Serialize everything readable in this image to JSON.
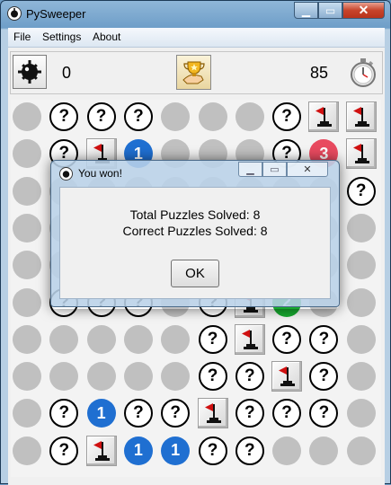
{
  "window": {
    "title": "PySweeper",
    "close_glyph": "✕",
    "min_glyph": "▁",
    "max_glyph": "▭"
  },
  "menu": {
    "items": [
      "File",
      "Settings",
      "About"
    ]
  },
  "toolbar": {
    "left_count": "0",
    "right_count": "85",
    "mine_icon": "mine-icon",
    "trophy_icon": "trophy-hand-icon",
    "timer_icon": "stopwatch-icon"
  },
  "colors": {
    "blank": "#c0c0c0",
    "one": "#1f6fd1",
    "two": "#17a82f",
    "three": "#e84a5f",
    "flag": "#d01010"
  },
  "board": {
    "rows": 10,
    "cols": 10,
    "cells": [
      [
        "b",
        "q",
        "q",
        "q",
        "b",
        "b",
        "b",
        "q",
        "f",
        "f"
      ],
      [
        "b",
        "q",
        "f",
        "1",
        "b",
        "b",
        "b",
        "q",
        "3",
        "f"
      ],
      [
        "b",
        "b",
        "b",
        "b",
        "b",
        "b",
        "b",
        "b",
        "b",
        "q"
      ],
      [
        "b",
        "b",
        "b",
        "b",
        "b",
        "b",
        "b",
        "b",
        "b",
        "b"
      ],
      [
        "b",
        "b",
        "b",
        "b",
        "b",
        "b",
        "b",
        "b",
        "b",
        "b"
      ],
      [
        "b",
        "q",
        "q",
        "q",
        "b",
        "q",
        "f",
        "2",
        "b",
        "b"
      ],
      [
        "b",
        "b",
        "b",
        "b",
        "b",
        "q",
        "f",
        "q",
        "q",
        "b"
      ],
      [
        "b",
        "b",
        "b",
        "b",
        "b",
        "q",
        "q",
        "f",
        "q",
        "b"
      ],
      [
        "b",
        "q",
        "1",
        "q",
        "q",
        "f",
        "q",
        "q",
        "q",
        "b"
      ],
      [
        "b",
        "q",
        "f",
        "1",
        "1",
        "q",
        "q",
        "b",
        "b",
        "b"
      ]
    ]
  },
  "dialog": {
    "title": "You won!",
    "line1": "Total Puzzles Solved: 8",
    "line2": "Correct Puzzles Solved: 8",
    "ok_label": "OK"
  }
}
